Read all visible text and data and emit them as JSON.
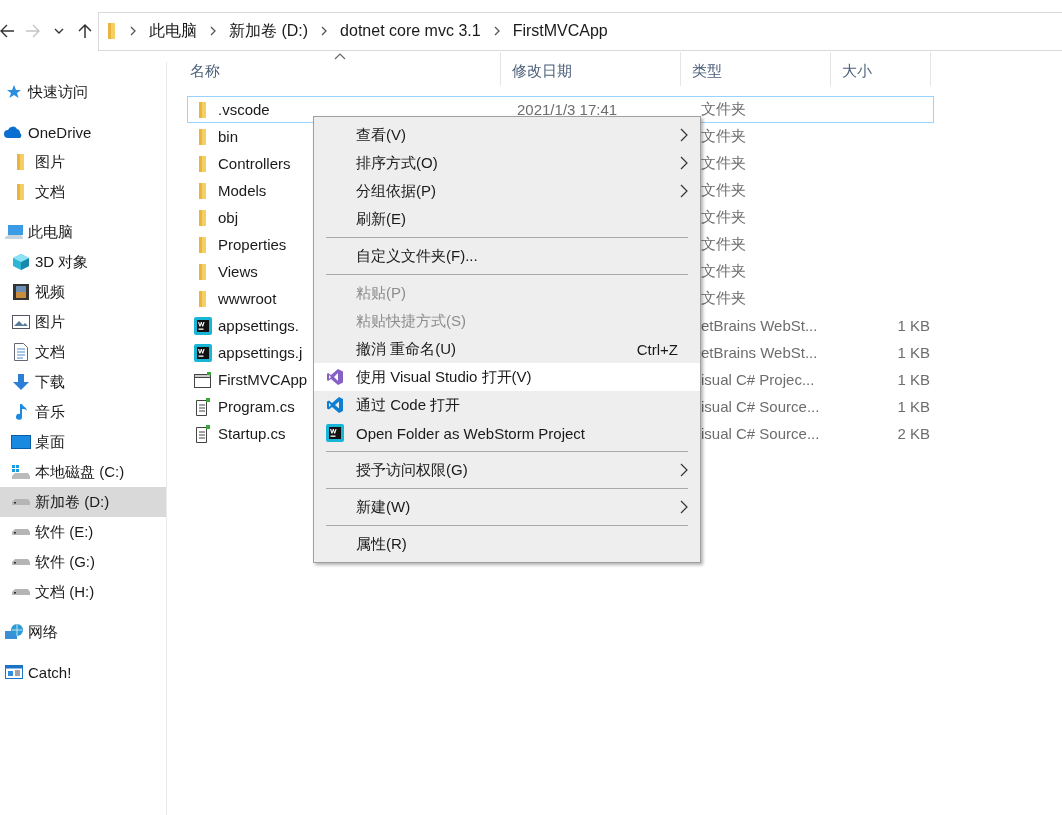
{
  "nav_buttons": [
    {
      "kind": "back",
      "disabled": false
    },
    {
      "kind": "forward",
      "disabled": true
    },
    {
      "kind": "recent",
      "disabled": false
    },
    {
      "kind": "up",
      "disabled": false
    }
  ],
  "breadcrumb": [
    "此电脑",
    "新加卷 (D:)",
    "dotnet core mvc 3.1",
    "FirstMVCApp"
  ],
  "sidebar": {
    "items": [
      {
        "kind": "star",
        "label": "快速访问",
        "selected": false
      },
      {
        "kind": "cloud",
        "label": "OneDrive",
        "selected": false,
        "children": [
          {
            "kind": "folder",
            "label": "图片",
            "selected": false
          },
          {
            "kind": "folder",
            "label": "文档",
            "selected": false
          }
        ]
      },
      {
        "kind": "pc",
        "label": "此电脑",
        "selected": false,
        "children": [
          {
            "kind": "cube",
            "label": "3D 对象",
            "selected": false
          },
          {
            "kind": "video",
            "label": "视频",
            "selected": false
          },
          {
            "kind": "picture",
            "label": "图片",
            "selected": false
          },
          {
            "kind": "doc",
            "label": "文档",
            "selected": false
          },
          {
            "kind": "download",
            "label": "下载",
            "selected": false
          },
          {
            "kind": "music",
            "label": "音乐",
            "selected": false
          },
          {
            "kind": "desktop",
            "label": "桌面",
            "selected": false
          },
          {
            "kind": "windrive",
            "label": "本地磁盘 (C:)",
            "selected": false
          },
          {
            "kind": "drive",
            "label": "新加卷 (D:)",
            "selected": true
          },
          {
            "kind": "drive",
            "label": "软件 (E:)",
            "selected": false
          },
          {
            "kind": "drive",
            "label": "软件 (G:)",
            "selected": false
          },
          {
            "kind": "drive",
            "label": "文档 (H:)",
            "selected": false
          }
        ]
      },
      {
        "kind": "network",
        "label": "网络",
        "selected": false
      },
      {
        "kind": "app",
        "label": "Catch!",
        "selected": false
      }
    ]
  },
  "table": {
    "columns": [
      {
        "label": "名称",
        "sorted": true
      },
      {
        "label": "修改日期",
        "sorted": false
      },
      {
        "label": "类型",
        "sorted": false
      },
      {
        "label": "大小",
        "sorted": false
      }
    ],
    "rows": [
      {
        "kind": "folder",
        "name": ".vscode",
        "date": "2021/1/3 17:41",
        "type": "文件夹",
        "selected": true
      },
      {
        "kind": "folder",
        "name": "bin",
        "type": "文件夹",
        "selected": false
      },
      {
        "kind": "folder",
        "name": "Controllers",
        "type": "文件夹",
        "selected": false
      },
      {
        "kind": "folder",
        "name": "Models",
        "type": "文件夹",
        "selected": false
      },
      {
        "kind": "folder",
        "name": "obj",
        "type": "文件夹",
        "selected": false
      },
      {
        "kind": "folder",
        "name": "Properties",
        "type": "文件夹",
        "selected": false
      },
      {
        "kind": "folder",
        "name": "Views",
        "type": "文件夹",
        "selected": false
      },
      {
        "kind": "folder",
        "name": "wwwroot",
        "type": "文件夹",
        "selected": false
      },
      {
        "kind": "webstorm",
        "name": "appsettings.",
        "type": "etBrains WebSt...",
        "size": "1 KB",
        "selected": false
      },
      {
        "kind": "webstorm",
        "name": "appsettings.j",
        "type": "etBrains WebSt...",
        "size": "1 KB",
        "selected": false
      },
      {
        "kind": "project",
        "name": "FirstMVCApp",
        "type": "isual C# Projec...",
        "size": "1 KB",
        "selected": false
      },
      {
        "kind": "csfile",
        "name": "Program.cs",
        "type": "isual C# Source...",
        "size": "1 KB",
        "selected": false
      },
      {
        "kind": "csfile",
        "name": "Startup.cs",
        "type": "isual C# Source...",
        "size": "2 KB",
        "selected": false
      }
    ]
  },
  "context_menu": {
    "items": [
      {
        "kind": "item",
        "label": "查看(V)",
        "submenu": true,
        "disabled": false,
        "selected": false
      },
      {
        "kind": "item",
        "label": "排序方式(O)",
        "submenu": true,
        "disabled": false,
        "selected": false
      },
      {
        "kind": "item",
        "label": "分组依据(P)",
        "submenu": true,
        "disabled": false,
        "selected": false
      },
      {
        "kind": "item",
        "label": "刷新(E)",
        "submenu": false,
        "disabled": false,
        "selected": false
      },
      {
        "kind": "separator"
      },
      {
        "kind": "item",
        "label": "自定义文件夹(F)...",
        "submenu": false,
        "disabled": false,
        "selected": false
      },
      {
        "kind": "separator"
      },
      {
        "kind": "item",
        "label": "粘贴(P)",
        "submenu": false,
        "disabled": true,
        "selected": false
      },
      {
        "kind": "item",
        "label": "粘贴快捷方式(S)",
        "submenu": false,
        "disabled": true,
        "selected": false
      },
      {
        "kind": "item",
        "label": "撤消 重命名(U)",
        "shortcut": "Ctrl+Z",
        "submenu": false,
        "disabled": false,
        "selected": false
      },
      {
        "kind": "vs-item",
        "label": "使用 Visual Studio 打开(V)",
        "submenu": false,
        "disabled": false,
        "selected": true
      },
      {
        "kind": "code-item",
        "label": "通过 Code 打开",
        "submenu": false,
        "disabled": false,
        "selected": false
      },
      {
        "kind": "webstorm-item",
        "label": "Open Folder as WebStorm Project",
        "submenu": false,
        "disabled": false,
        "selected": false
      },
      {
        "kind": "separator"
      },
      {
        "kind": "item",
        "label": "授予访问权限(G)",
        "submenu": true,
        "disabled": false,
        "selected": false
      },
      {
        "kind": "separator"
      },
      {
        "kind": "item",
        "label": "新建(W)",
        "submenu": true,
        "disabled": false,
        "selected": false
      },
      {
        "kind": "separator"
      },
      {
        "kind": "item",
        "label": "属性(R)",
        "submenu": false,
        "disabled": false,
        "selected": false
      }
    ]
  }
}
